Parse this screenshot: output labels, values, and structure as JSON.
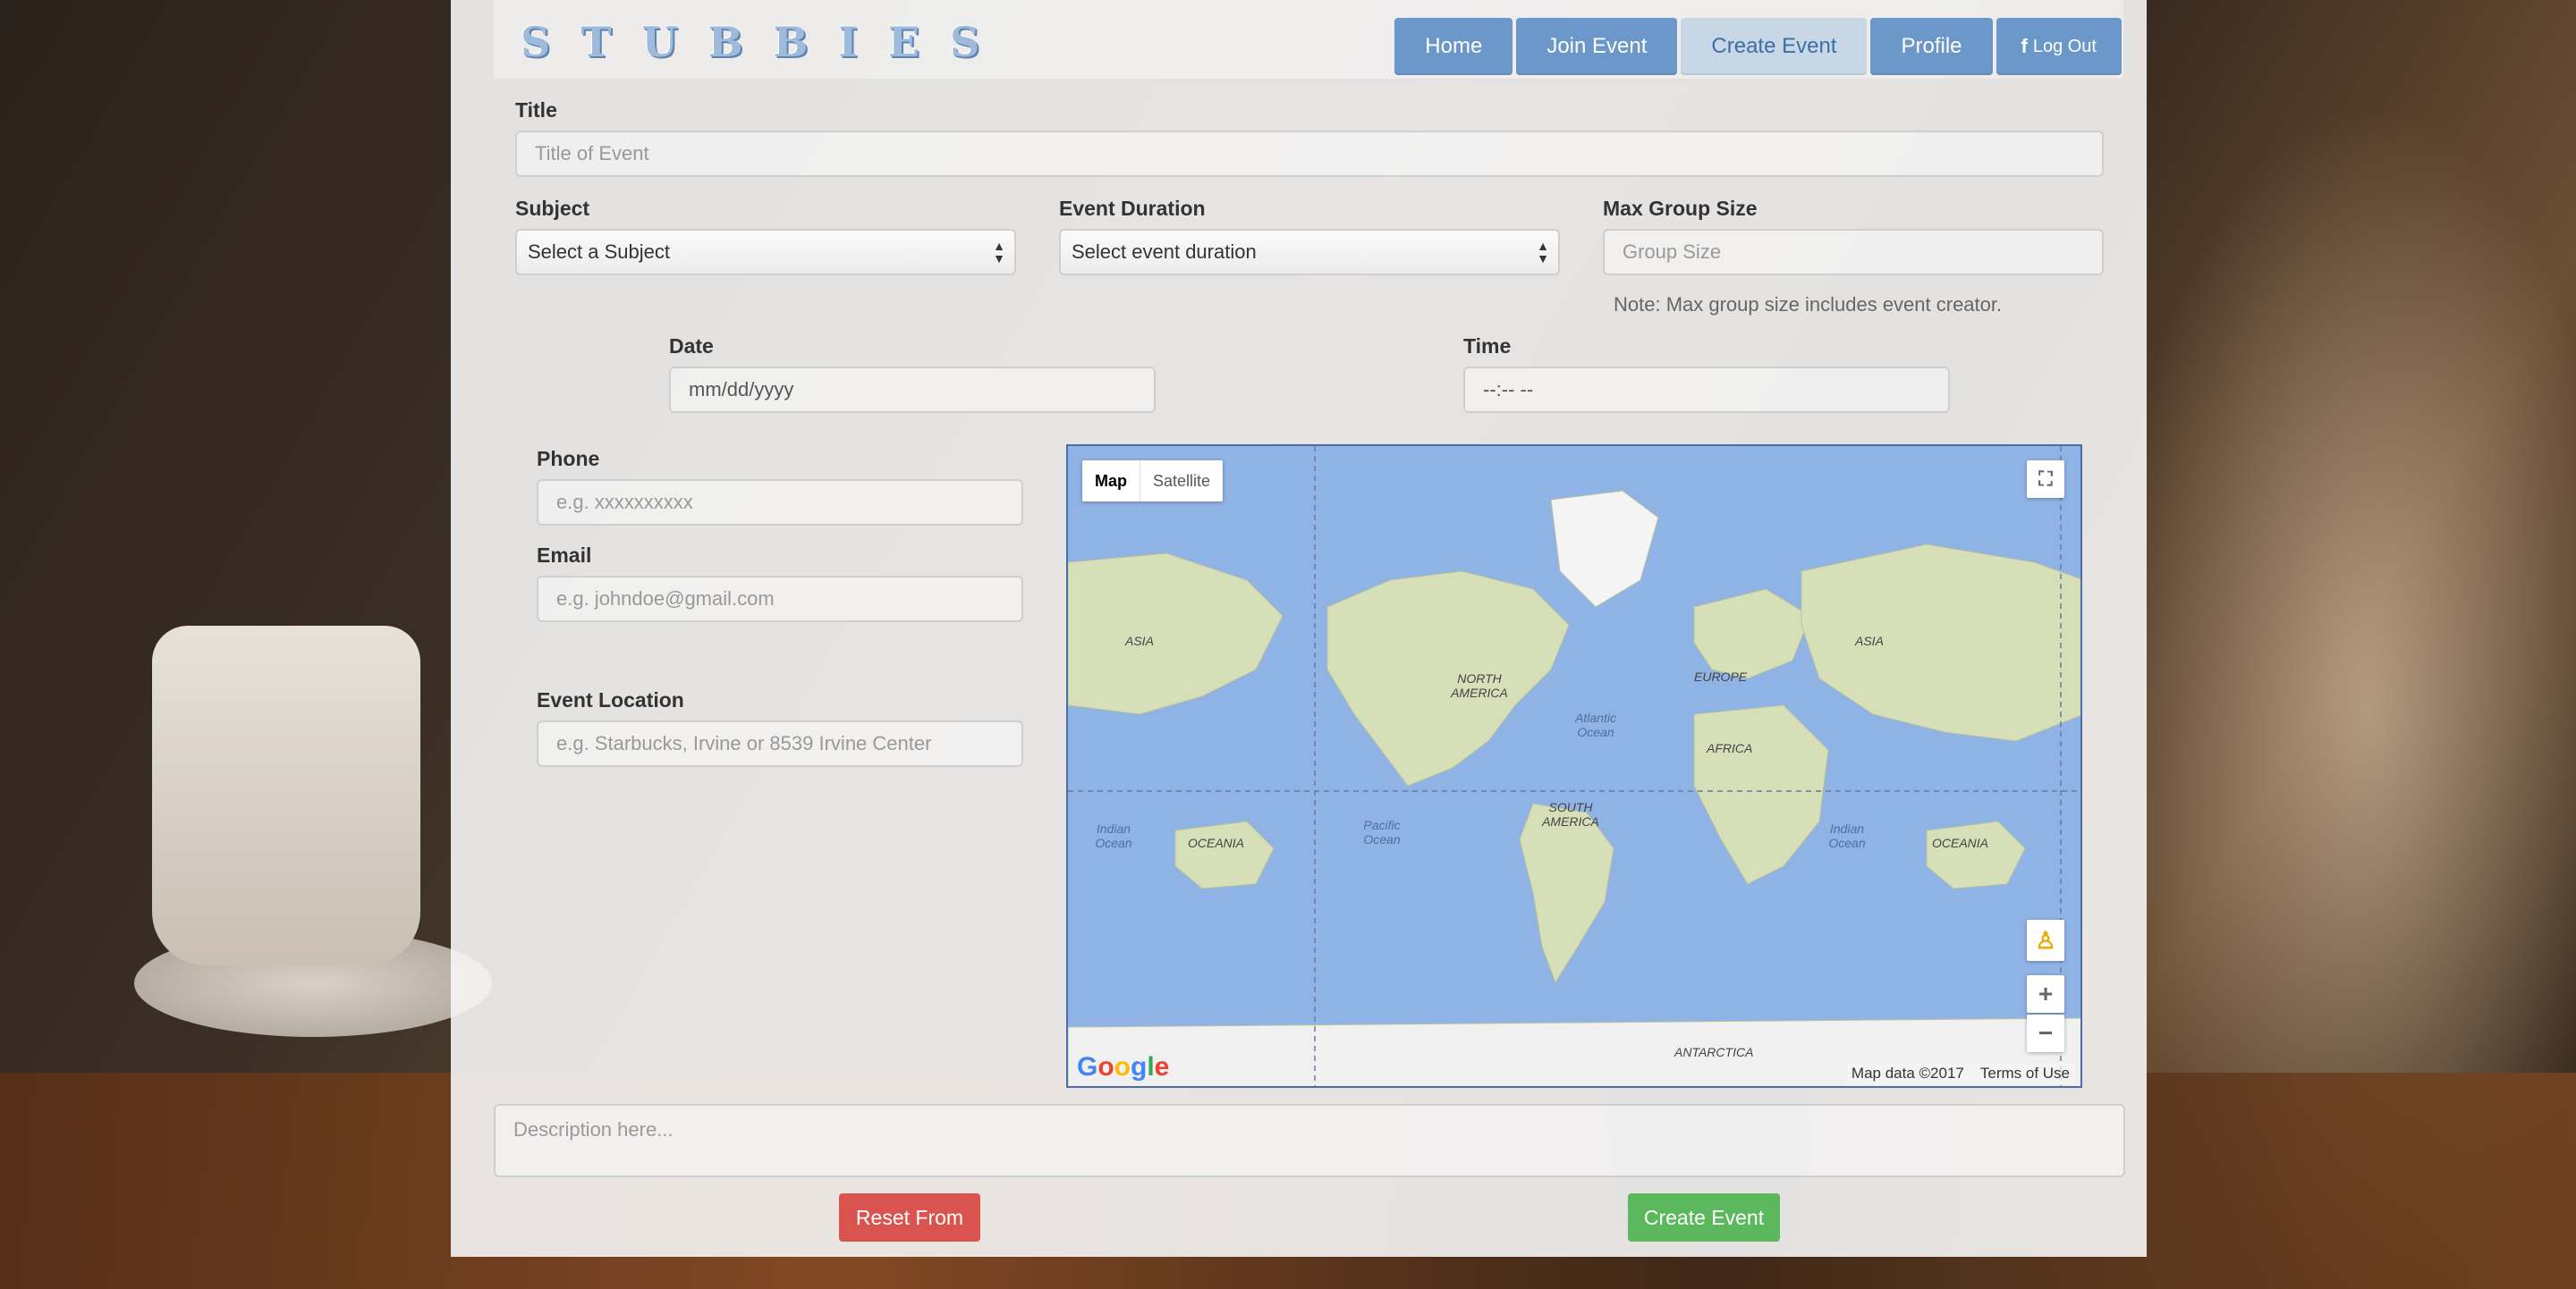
{
  "brand": {
    "letters": [
      "S",
      "T",
      "U",
      "B",
      "B",
      "I",
      "E",
      "S"
    ]
  },
  "nav": {
    "home": "Home",
    "join_event": "Join Event",
    "create_event": "Create Event",
    "profile": "Profile",
    "logout_icon": "f",
    "logout": "Log Out"
  },
  "form": {
    "title_label": "Title",
    "title_placeholder": "Title of Event",
    "subject_label": "Subject",
    "subject_value": "Select a Subject",
    "duration_label": "Event Duration",
    "duration_value": "Select event duration",
    "group_label": "Max Group Size",
    "group_placeholder": "Group Size",
    "group_note": "Note: Max group size includes event creator.",
    "date_label": "Date",
    "date_value": "mm/dd/yyyy",
    "time_label": "Time",
    "time_value": "--:-- --",
    "phone_label": "Phone",
    "phone_placeholder": "e.g. xxxxxxxxxx",
    "email_label": "Email",
    "email_placeholder": "e.g. johndoe@gmail.com",
    "location_label": "Event Location",
    "location_placeholder": "e.g. Starbucks, Irvine or 8539 Irvine Center",
    "description_placeholder": "Description here..."
  },
  "map": {
    "type_map": "Map",
    "type_satellite": "Satellite",
    "labels": {
      "asia_left": "ASIA",
      "north_america": "NORTH AMERICA",
      "europe": "EUROPE",
      "asia_right": "ASIA",
      "atlantic": "Atlantic Ocean",
      "africa": "AFRICA",
      "south_america": "SOUTH AMERICA",
      "indian_left": "Indian Ocean",
      "oceania_left": "OCEANIA",
      "pacific": "Pacific Ocean",
      "indian_right": "Indian Ocean",
      "oceania_right": "OCEANIA",
      "antarctica": "ANTARCTICA"
    },
    "logo": [
      "G",
      "o",
      "o",
      "g",
      "l",
      "e"
    ],
    "map_data": "Map data ©2017",
    "terms": "Terms of Use",
    "zoom_in": "+",
    "zoom_out": "−",
    "fullscreen_icon": "fullscreen-icon",
    "pegman_icon": "pegman-icon"
  },
  "buttons": {
    "reset": "Reset From",
    "create": "Create Event"
  }
}
